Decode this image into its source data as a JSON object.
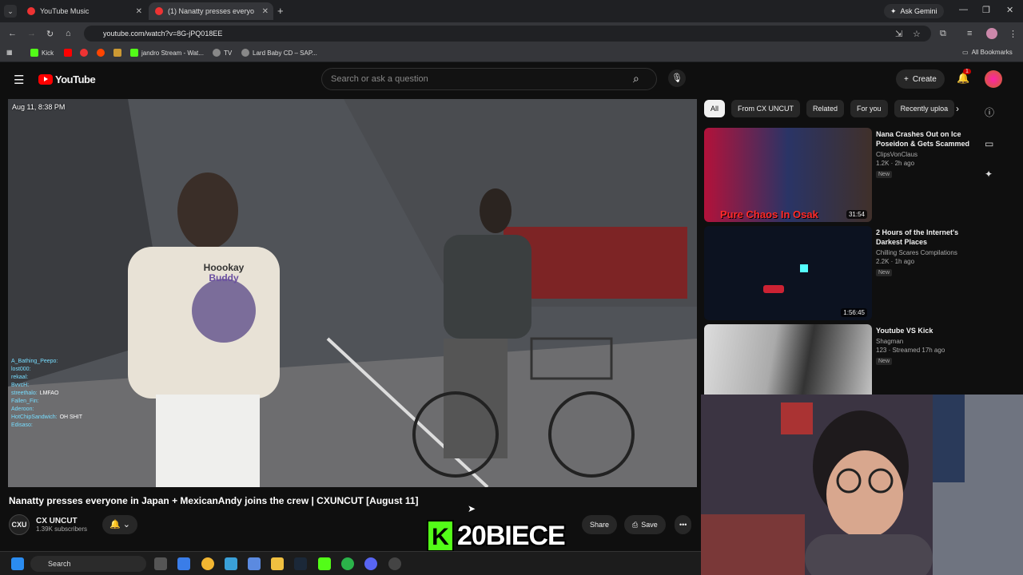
{
  "browser": {
    "tabs": [
      {
        "title": "YouTube Music"
      },
      {
        "title": "(1) Nanatty presses everyo"
      }
    ],
    "ask_gemini": "Ask Gemini",
    "url": "youtube.com/watch?v=8G-jPQ018EE",
    "bookmarks": [
      {
        "label": "Kick"
      },
      {
        "label": "jandro Stream - Wat..."
      },
      {
        "label": "TV"
      },
      {
        "label": "Lard Baby CD – SAP..."
      }
    ],
    "all_bookmarks": "All Bookmarks"
  },
  "youtube": {
    "logo_text": "YouTube",
    "search_placeholder": "Search or ask a question",
    "create_label": "Create",
    "notif_count": "1"
  },
  "video": {
    "timestamp": "Aug 11, 8:38 PM",
    "title": "Nanatty presses everyone in Japan + MexicanAndy joins the crew | CXUNCUT [August 11]",
    "shirt_text_1": "Hoookay",
    "shirt_text_2": "Buddy",
    "chat": [
      {
        "user": "A_Bathing_Peepo:",
        "msg": ""
      },
      {
        "user": "lost000:",
        "msg": ""
      },
      {
        "user": "rekaal:",
        "msg": ""
      },
      {
        "user": "BvvcH:",
        "msg": ""
      },
      {
        "user": "streethalo:",
        "msg": "LMFAO"
      },
      {
        "user": "Fallen_Fin:",
        "msg": ""
      },
      {
        "user": "Aderoon:",
        "msg": ""
      },
      {
        "user": "HotChipSandwich:",
        "msg": "OH SHIT"
      },
      {
        "user": "Edisaso:",
        "msg": ""
      }
    ]
  },
  "channel": {
    "avatar_text": "CXU",
    "name": "CX UNCUT",
    "subscribers": "1.39K subscribers",
    "share_label": "Share",
    "save_label": "Save"
  },
  "chips": [
    "All",
    "From CX UNCUT",
    "Related",
    "For you",
    "Recently uploa"
  ],
  "recommendations": [
    {
      "title": "Nana Crashes Out on Ice Poseidon & Gets Scammed",
      "channel": "ClipsVonClaus",
      "stats": "1.2K · 2h ago",
      "badge": "New",
      "duration": "31:54",
      "thumb_caption": "Pure Chaos In Osak"
    },
    {
      "title": "2 Hours of the Internet's Darkest Places",
      "channel": "Chilling Scares Compilations",
      "stats": "2.2K · 1h ago",
      "badge": "New",
      "duration": "1:56:45",
      "thumb_caption": ""
    },
    {
      "title": "Youtube VS Kick",
      "channel": "Shagman",
      "stats": "123 · Streamed 17h ago",
      "badge": "New",
      "duration": "",
      "thumb_caption": ""
    }
  ],
  "overlay": {
    "k_letter": "K",
    "text": "20BIECE"
  },
  "taskbar": {
    "search_label": "Search"
  },
  "colors": {
    "accent": "#ff0000",
    "kick_green": "#53fc18",
    "bg": "#0f0f0f"
  }
}
